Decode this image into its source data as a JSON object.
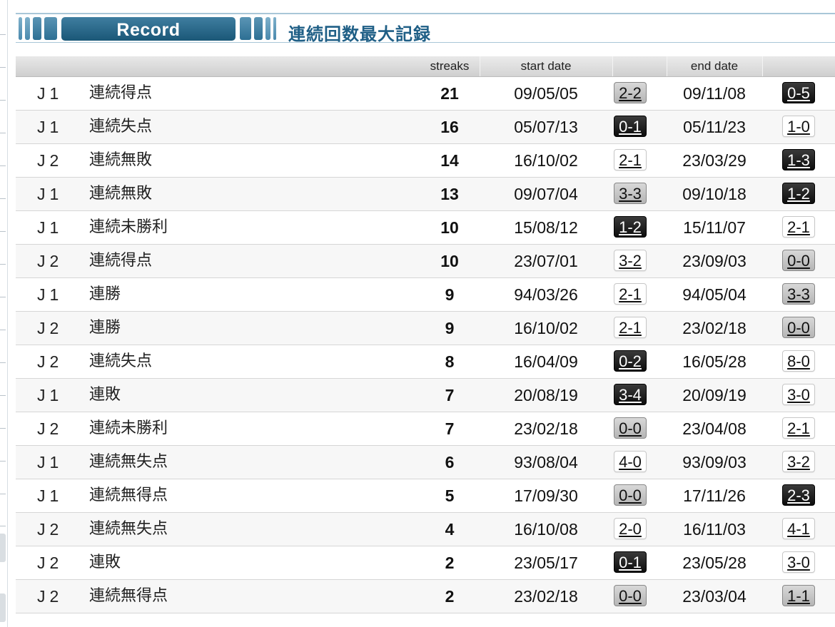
{
  "header": {
    "tab_label": "Record",
    "title": "連続回数最大記録"
  },
  "table": {
    "columns": {
      "streaks": "streaks",
      "start_date": "start date",
      "end_date": "end date"
    },
    "rows": [
      {
        "league": "J1",
        "type": "連続得点",
        "streaks": "21",
        "start_date": "09/05/05",
        "start_score": "2-2",
        "start_result": "draw",
        "end_date": "09/11/08",
        "end_score": "0-5",
        "end_result": "loss"
      },
      {
        "league": "J1",
        "type": "連続失点",
        "streaks": "16",
        "start_date": "05/07/13",
        "start_score": "0-1",
        "start_result": "loss",
        "end_date": "05/11/23",
        "end_score": "1-0",
        "end_result": "win"
      },
      {
        "league": "J2",
        "type": "連続無敗",
        "streaks": "14",
        "start_date": "16/10/02",
        "start_score": "2-1",
        "start_result": "win",
        "end_date": "23/03/29",
        "end_score": "1-3",
        "end_result": "loss"
      },
      {
        "league": "J1",
        "type": "連続無敗",
        "streaks": "13",
        "start_date": "09/07/04",
        "start_score": "3-3",
        "start_result": "draw",
        "end_date": "09/10/18",
        "end_score": "1-2",
        "end_result": "loss"
      },
      {
        "league": "J1",
        "type": "連続未勝利",
        "streaks": "10",
        "start_date": "15/08/12",
        "start_score": "1-2",
        "start_result": "loss",
        "end_date": "15/11/07",
        "end_score": "2-1",
        "end_result": "win"
      },
      {
        "league": "J2",
        "type": "連続得点",
        "streaks": "10",
        "start_date": "23/07/01",
        "start_score": "3-2",
        "start_result": "win",
        "end_date": "23/09/03",
        "end_score": "0-0",
        "end_result": "draw"
      },
      {
        "league": "J1",
        "type": "連勝",
        "streaks": "9",
        "start_date": "94/03/26",
        "start_score": "2-1",
        "start_result": "win",
        "end_date": "94/05/04",
        "end_score": "3-3",
        "end_result": "draw"
      },
      {
        "league": "J2",
        "type": "連勝",
        "streaks": "9",
        "start_date": "16/10/02",
        "start_score": "2-1",
        "start_result": "win",
        "end_date": "23/02/18",
        "end_score": "0-0",
        "end_result": "draw"
      },
      {
        "league": "J2",
        "type": "連続失点",
        "streaks": "8",
        "start_date": "16/04/09",
        "start_score": "0-2",
        "start_result": "loss",
        "end_date": "16/05/28",
        "end_score": "8-0",
        "end_result": "win"
      },
      {
        "league": "J1",
        "type": "連敗",
        "streaks": "7",
        "start_date": "20/08/19",
        "start_score": "3-4",
        "start_result": "loss",
        "end_date": "20/09/19",
        "end_score": "3-0",
        "end_result": "win"
      },
      {
        "league": "J2",
        "type": "連続未勝利",
        "streaks": "7",
        "start_date": "23/02/18",
        "start_score": "0-0",
        "start_result": "draw",
        "end_date": "23/04/08",
        "end_score": "2-1",
        "end_result": "win"
      },
      {
        "league": "J1",
        "type": "連続無失点",
        "streaks": "6",
        "start_date": "93/08/04",
        "start_score": "4-0",
        "start_result": "win",
        "end_date": "93/09/03",
        "end_score": "3-2",
        "end_result": "win"
      },
      {
        "league": "J1",
        "type": "連続無得点",
        "streaks": "5",
        "start_date": "17/09/30",
        "start_score": "0-0",
        "start_result": "draw",
        "end_date": "17/11/26",
        "end_score": "2-3",
        "end_result": "loss"
      },
      {
        "league": "J2",
        "type": "連続無失点",
        "streaks": "4",
        "start_date": "16/10/08",
        "start_score": "2-0",
        "start_result": "win",
        "end_date": "16/11/03",
        "end_score": "4-1",
        "end_result": "win"
      },
      {
        "league": "J2",
        "type": "連敗",
        "streaks": "2",
        "start_date": "23/05/17",
        "start_score": "0-1",
        "start_result": "loss",
        "end_date": "23/05/28",
        "end_score": "3-0",
        "end_result": "win"
      },
      {
        "league": "J2",
        "type": "連続無得点",
        "streaks": "2",
        "start_date": "23/02/18",
        "start_score": "0-0",
        "start_result": "draw",
        "end_date": "23/03/04",
        "end_score": "1-1",
        "end_result": "draw"
      }
    ]
  }
}
